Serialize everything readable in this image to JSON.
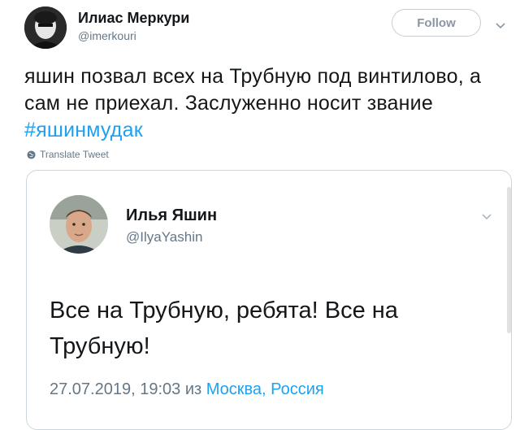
{
  "tweet": {
    "author_name": "Илиас Меркури",
    "author_handle": "@imerkouri",
    "follow_label": "Follow",
    "text_main": "яшин позвал всех на Трубную под винтилово, а сам не приехал. Заслуженно носит звание ",
    "hashtag": "#яшинмудак",
    "translate_label": "Translate Tweet"
  },
  "quoted": {
    "author_name": "Илья Яшин",
    "author_handle": "@IlyaYashin",
    "text": "Все на Трубную, ребята! Все на Трубную!",
    "timestamp": "27.07.2019, 19:03",
    "from_word": "из",
    "location": "Москва, Россия"
  },
  "colors": {
    "link": "#1da1f2",
    "secondary_text": "#657786",
    "border": "#ccd6dd"
  },
  "icons": [
    "chevron-down-icon",
    "globe-icon"
  ]
}
